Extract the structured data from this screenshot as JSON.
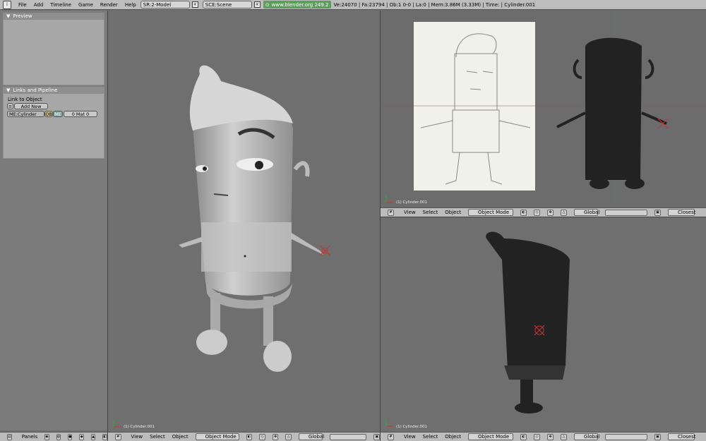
{
  "topbar": {
    "menus": [
      "File",
      "Add",
      "Timeline",
      "Game",
      "Render",
      "Help"
    ],
    "screen": "SR:2-Model",
    "scene": "SCE:Scene",
    "url": "www.blender.org 249.2",
    "stats": "Ve:24070 | Fa:23794 | Ob:1 0-0 | La:0 | Mem:3.86M (3.33M) | Time: | Cylinder.001"
  },
  "left": {
    "preview_title": "Preview",
    "links_title": "Links and Pipeline",
    "link_to_object": "Link to Object",
    "add_new": "Add New",
    "mesh_name": "ME:Cylinder",
    "ob_label": "OB",
    "me_label": "ME",
    "mat_label": "0 Mat 0"
  },
  "viewports": {
    "label": "(1) Cylinder.001"
  },
  "header": {
    "view": "View",
    "select": "Select",
    "object": "Object",
    "mode": "Object Mode",
    "orientation": "Global",
    "snap": "Closest",
    "panels": "Panels"
  }
}
